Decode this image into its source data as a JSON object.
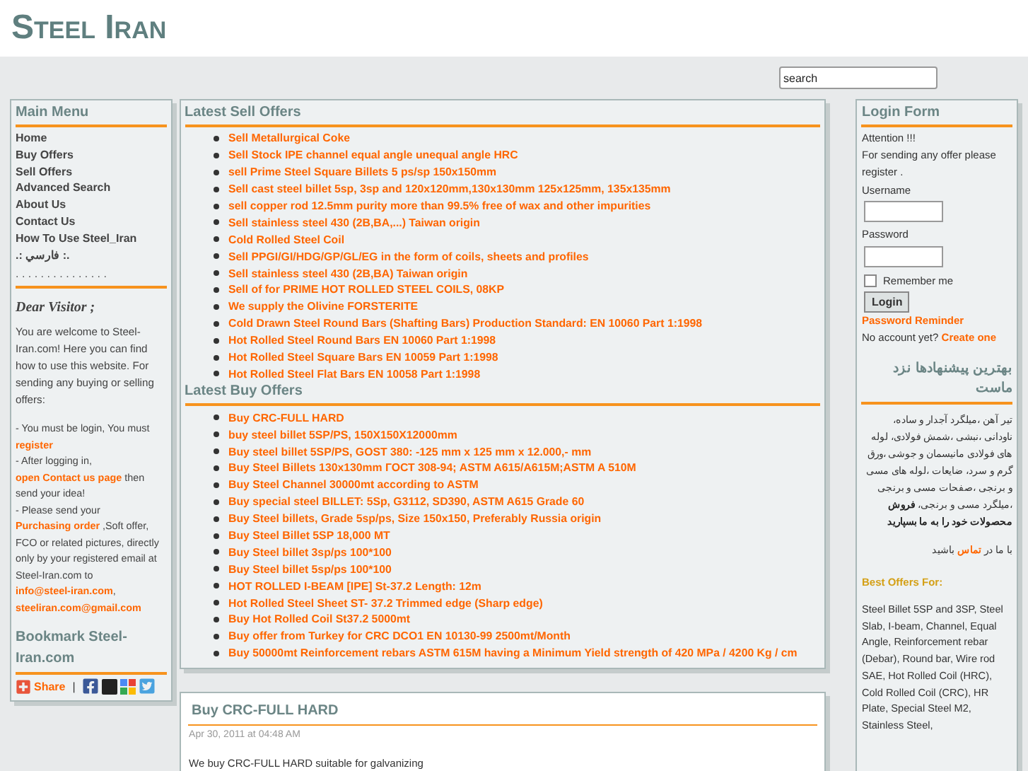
{
  "site_title": "Steel Iran",
  "search": {
    "placeholder": "search"
  },
  "main_menu": {
    "title": "Main Menu",
    "items": [
      "Home",
      "Buy Offers",
      "Sell Offers",
      "Advanced Search",
      "About Us",
      "Contact Us",
      "How To Use Steel_Iran",
      ".: فارسي :."
    ],
    "separator": ". . . . . . . . . . . . . . ."
  },
  "visitor_note": {
    "title": "Dear Visitor ;",
    "intro": "You are welcome to Steel-Iran.com! Here you can find how to use this website. For sending any buying or selling offers:",
    "points": [
      [
        {
          "text": "-   You must be login, You must "
        },
        {
          "text": "register",
          "link": true
        }
      ],
      [
        {
          "text": "-   After logging in, "
        },
        {
          "text": "open Contact us page",
          "link": true
        },
        {
          "text": " then send your idea!"
        }
      ],
      [
        {
          "text": "-   Please send your "
        },
        {
          "text": "Purchasing order",
          "link": true
        },
        {
          "text": " ,Soft offer, FCO or related pictures, directly only by your registered email at Steel-Iran.com to "
        },
        {
          "text": "info@steel-iran.com",
          "link": true
        },
        {
          "text": ", "
        },
        {
          "text": "steeliran.com@gmail.com",
          "link": true
        }
      ]
    ]
  },
  "bookmark": {
    "title": "Bookmark Steel-Iran.com",
    "share_label": "Share",
    "divider": "|"
  },
  "sell_offers": {
    "title": "Latest Sell Offers",
    "items": [
      "Sell Metallurgical Coke",
      "Sell Stock IPE channel equal angle unequal angle HRC",
      "sell Prime Steel Square Billets 5 ps/sp 150x150mm",
      "Sell cast steel billet 5sp, 3sp and  120x120mm,130x130mm  125x125mm, 135x135mm",
      "sell copper rod 12.5mm purity more than 99.5% free of wax and other impurities",
      "Sell stainless steel 430 (2B,BA,...) Taiwan origin",
      "Cold Rolled Steel Coil",
      "Sell PPGI/GI/HDG/GP/GL/EG in the form of coils, sheets and profiles",
      "Sell stainless steel 430 (2B,BA) Taiwan origin",
      "Sell of for PRIME HOT ROLLED STEEL COILS, 08KP",
      "We supply the Olivine FORSTERITE",
      "Cold Drawn Steel Round Bars (Shafting Bars) Production Standard: EN 10060 Part 1:1998",
      "Hot Rolled Steel Round Bars EN 10060 Part 1:1998",
      "Hot Rolled Steel Square Bars EN 10059 Part 1:1998",
      "Hot Rolled Steel Flat Bars EN 10058 Part 1:1998"
    ]
  },
  "buy_offers": {
    "title": "Latest Buy Offers",
    "items": [
      "Buy CRC-FULL HARD",
      "buy steel billet 5SP/PS, 150X150X12000mm",
      "Buy steel billet 5SP/PS, GOST 380: -125 mm x 125 mm x 12.000,- mm",
      "Buy Steel Billets 130x130mm ГОСТ 308-94; ASTM A615/A615M;ASTM A 510M",
      "Buy Steel Channel 30000mt according to ASTM",
      "Buy special steel BILLET: 5Sp, G3112, SD390, ASTM A615 Grade 60",
      "Buy Steel billets, Grade 5sp/ps, Size 150x150, Preferably Russia origin",
      "Buy Steel Billet 5SP 18,000 MT",
      "Buy Steel billet 3sp/ps 100*100",
      "Buy Steel billet 5sp/ps 100*100",
      "HOT ROLLED I-BEAM [IPE] St-37.2 Length: 12m",
      "Hot Rolled Steel Sheet ST- 37.2 Trimmed edge (Sharp edge)",
      "Buy Hot Rolled Coil St37.2 5000mt",
      "Buy offer from Turkey for CRC DCO1 EN 10130-99 2500mt/Month",
      "Buy 50000mt Reinforcement rebars ASTM 615M having a Minimum Yield strength of 420 MPa / 4200 Kg / cm"
    ]
  },
  "post": {
    "title": "Buy CRC-FULL HARD",
    "date": "Apr 30, 2011 at 04:48 AM",
    "body": "We buy CRC-FULL HARD suitable for galvanizing"
  },
  "login": {
    "title": "Login Form",
    "notice": "Attention !!!",
    "notice_detail": "For sending any offer please register .",
    "username_label": "Username",
    "password_label": "Password",
    "remember_label": "Remember me",
    "remember_checked": false,
    "button": "Login",
    "reminder": "Password Reminder",
    "no_account": "No account yet?",
    "create": "Create one"
  },
  "persian": {
    "title": "بهترین پیشنهادها نزد ماست",
    "body": "تیر آهن ،میلگرد آجدار و ساده، ناودانی ،نبشی ،شمش فولادی، لوله های فولادی مانیسمان و جوشی ،ورق گرم و سرد، ضایعات ،لوله های مسی و برنجی ،صفحات مسی و برنجی ،میلگرد مسی و برنجی، **فروش محصولات خود را به ما بسپارید**",
    "contact": [
      {
        "text": "با ما در "
      },
      {
        "text": "تماس",
        "link": true
      },
      {
        "text": " باشید"
      }
    ]
  },
  "best_offers": {
    "title": "Best Offers For:",
    "body": "Steel Billet 5SP and 3SP, Steel Slab, I-beam, Channel, Equal Angle, Reinforcement rebar (Debar), Round bar, Wire rod SAE, Hot Rolled Coil (HRC), Cold Rolled Coil (CRC), HR Plate, Special Steel M2, Stainless Steel,"
  }
}
